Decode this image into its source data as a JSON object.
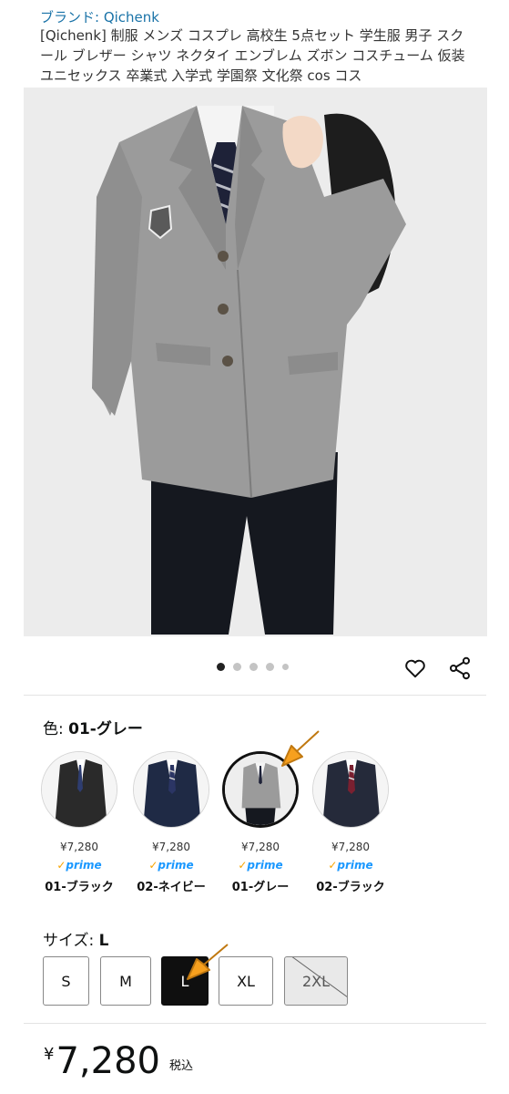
{
  "brand_link": "ブランド: Qichenk",
  "product_title": "[Qichenk] 制服 メンズ コスプレ 高校生 5点セット 学生服 男子 スクール ブレザー シャツ ネクタイ エンブレム ズボン コスチューム 仮装 ユニセックス 卒業式 入学式 学園祭 文化祭 cos コス",
  "gallery": {
    "image_count": 5,
    "active_index": 0
  },
  "icons": {
    "favorite": "heart-icon",
    "share": "share-icon"
  },
  "color": {
    "label": "色: ",
    "selected": "01-グレー",
    "options": [
      {
        "name": "01-ブラック",
        "price": "¥7,280",
        "prime": "prime",
        "jacket_color": "#2a2a2a",
        "selected": false
      },
      {
        "name": "02-ネイビー",
        "price": "¥7,280",
        "prime": "prime",
        "jacket_color": "#1f2a45",
        "selected": false
      },
      {
        "name": "01-グレー",
        "price": "¥7,280",
        "prime": "prime",
        "jacket_color": "#9a9a9a",
        "selected": true
      },
      {
        "name": "02-ブラック",
        "price": "¥7,280",
        "prime": "prime",
        "jacket_color": "#252a3a",
        "selected": false
      }
    ]
  },
  "size": {
    "label": "サイズ: ",
    "selected": "L",
    "options": [
      {
        "label": "S",
        "state": "available"
      },
      {
        "label": "M",
        "state": "available"
      },
      {
        "label": "L",
        "state": "selected"
      },
      {
        "label": "XL",
        "state": "available"
      },
      {
        "label": "2XL",
        "state": "unavailable"
      }
    ]
  },
  "price": {
    "currency": "¥",
    "amount": "7,280",
    "tax_note": "税込"
  },
  "colors": {
    "brand_link": "#1a73a8",
    "prime_blue": "#1a98ff",
    "arrow_orange": "#f7a01e"
  }
}
